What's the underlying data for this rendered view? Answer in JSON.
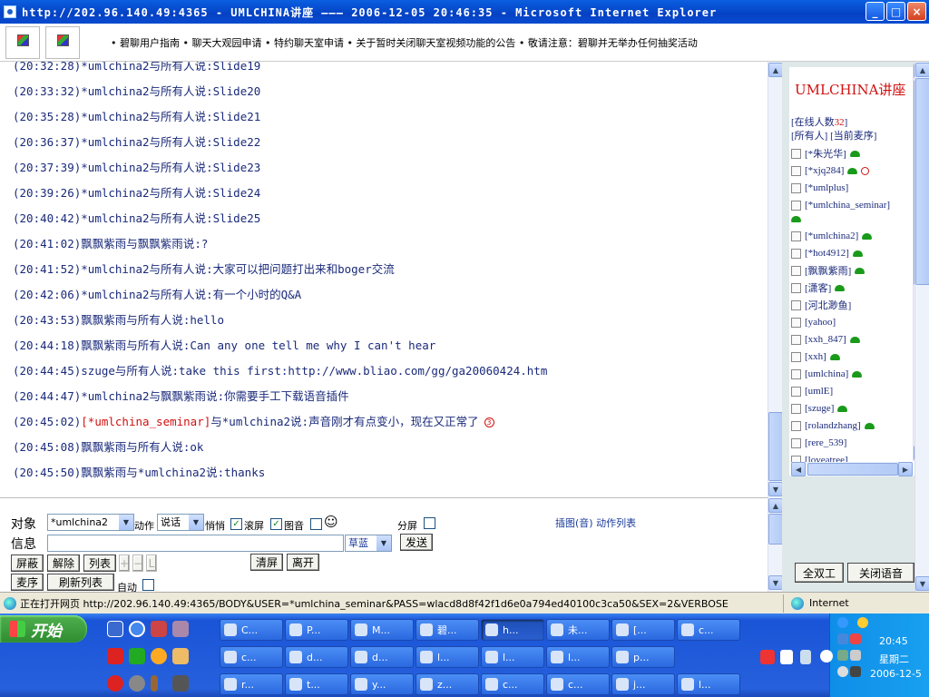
{
  "window": {
    "title": "http://202.96.140.49:4365 - UMLCHINA讲座 ——— 2006-12-05 20:46:35 - Microsoft Internet Explorer",
    "buttons": {
      "minimize": "_",
      "maximize": "□",
      "close": "×"
    }
  },
  "topbar": {
    "marquee": "• 碧聊用户指南 • 聊天大观园申请 • 特约聊天室申请 • 关于暂时关闭聊天室视频功能的公告 • 敬请注意：碧聊并无举办任何抽奖活动"
  },
  "chat": {
    "messages": [
      {
        "time": "(20:32:28)",
        "from": "*umlchina2",
        "mid": "与",
        "to": "所有人",
        "verb": "说:",
        "text": "Slide19"
      },
      {
        "time": "(20:33:32)",
        "from": "*umlchina2",
        "mid": "与",
        "to": "所有人",
        "verb": "说:",
        "text": "Slide20"
      },
      {
        "time": "(20:35:28)",
        "from": "*umlchina2",
        "mid": "与",
        "to": "所有人",
        "verb": "说:",
        "text": "Slide21"
      },
      {
        "time": "(20:36:37)",
        "from": "*umlchina2",
        "mid": "与",
        "to": "所有人",
        "verb": "说:",
        "text": "Slide22"
      },
      {
        "time": "(20:37:39)",
        "from": "*umlchina2",
        "mid": "与",
        "to": "所有人",
        "verb": "说:",
        "text": "Slide23"
      },
      {
        "time": "(20:39:26)",
        "from": "*umlchina2",
        "mid": "与",
        "to": "所有人",
        "verb": "说:",
        "text": "Slide24"
      },
      {
        "time": "(20:40:42)",
        "from": "*umlchina2",
        "mid": "与",
        "to": "所有人",
        "verb": "说:",
        "text": "Slide25"
      },
      {
        "time": "(20:41:02)",
        "from": "飘飘紫雨",
        "mid": "与",
        "to": "飘飘紫雨",
        "verb": "说:",
        "text": "?"
      },
      {
        "time": "(20:41:52)",
        "from": "*umlchina2",
        "mid": "与",
        "to": "所有人",
        "verb": "说:",
        "text": "大家可以把问题打出来和boger交流"
      },
      {
        "time": "(20:42:06)",
        "from": "*umlchina2",
        "mid": "与",
        "to": "所有人",
        "verb": "说:",
        "text": "有一个小时的Q&A"
      },
      {
        "time": "(20:43:53)",
        "from": "飘飘紫雨",
        "mid": "与",
        "to": "所有人",
        "verb": "说:",
        "text": "hello"
      },
      {
        "time": "(20:44:18)",
        "from": "飘飘紫雨",
        "mid": "与",
        "to": "所有人",
        "verb": "说:",
        "text": "Can any one tell me why I can't hear"
      },
      {
        "time": "(20:44:45)",
        "from": "szuge",
        "mid": "与",
        "to": "所有人",
        "verb": "说:",
        "text": "take this first:http://www.bliao.com/gg/ga20060424.htm"
      },
      {
        "time": "(20:44:47)",
        "from": "*umlchina2",
        "mid": "与",
        "to": "飘飘紫雨",
        "verb": "说:",
        "text": "你需要手工下载语音插件"
      },
      {
        "time": "(20:45:02)",
        "from": "[*umlchina_seminar]",
        "mid": "与",
        "to": "*umlchina2",
        "verb": "说:",
        "text": "声音刚才有点变小，现在又正常了"
      },
      {
        "time": "(20:45:08)",
        "from": "飘飘紫雨",
        "mid": "与",
        "to": "所有人",
        "verb": "说:",
        "text": "ok"
      },
      {
        "time": "(20:45:50)",
        "from": "飘飘紫雨",
        "mid": "与",
        "to": "*umlchina2",
        "verb": "说:",
        "text": "thanks"
      }
    ]
  },
  "controls": {
    "target_label": "对象",
    "target_value": "*umlchina2",
    "action_label": "动作",
    "action_value": "说话",
    "quiet_label": "悄悄",
    "scroll_label": "滚屏",
    "scroll_checked": "✓",
    "picsound_label": "图音",
    "picsound_checked": "✓",
    "smiley": "☺",
    "split_label": "分屏",
    "info_label": "信息",
    "color_value": "草蓝",
    "send": "发送",
    "block": "屏蔽",
    "unblock": "解除",
    "list": "列表",
    "plus": "+",
    "minus": "−",
    "l": "L",
    "clear": "清屏",
    "leave": "离开",
    "mic_order": "麦序",
    "refresh": "刷新列表",
    "auto_label": "自动",
    "insert_link": "插图(音) 动作列表"
  },
  "right": {
    "title": "UMLCHINA讲座",
    "online_prefix": "[在线人数",
    "online_count": "32",
    "online_suffix": "]",
    "tabs": "[所有人] [当前麦序]",
    "users": [
      {
        "name": "[*朱光华]",
        "phone": true
      },
      {
        "name": "[*xjq284]",
        "phone": true,
        "alert": true
      },
      {
        "name": "[*umlplus]"
      },
      {
        "name": "[*umlchina_seminar]",
        "phone_below": true
      },
      {
        "name": "[*umlchina2]",
        "phone": true
      },
      {
        "name": "[*hot4912]",
        "phone": true
      },
      {
        "name": "[飘飘紫雨]",
        "phone": true
      },
      {
        "name": "[潇客]",
        "phone": true
      },
      {
        "name": "[河北渺鱼]"
      },
      {
        "name": "[yahoo]"
      },
      {
        "name": "[xxh_847]",
        "phone": true
      },
      {
        "name": "[xxh]",
        "phone": true
      },
      {
        "name": "[umlchina]",
        "phone": true
      },
      {
        "name": "[umlE]"
      },
      {
        "name": "[szuge]",
        "phone": true
      },
      {
        "name": "[rolandzhang]",
        "phone": true
      },
      {
        "name": "[rere_539]"
      },
      {
        "name": "[loveatree]"
      }
    ],
    "duplex": "全双工",
    "close_voice": "关闭语音"
  },
  "status": {
    "loading": "正在打开网页 http://202.96.140.49:4365/BODY&USER=*umlchina_seminar&PASS=wlacd8d8f42f1d6e0a794ed40100c3ca50&SEX=2&VERBOSE",
    "zone": "Internet"
  },
  "taskbar": {
    "start": "开始",
    "row1": [
      "C...",
      "P...",
      "M...",
      "h...",
      "h...",
      "未...",
      "[...",
      "c..."
    ],
    "row2": [
      "c...",
      "d...",
      "d...",
      "l...",
      "l...",
      "l...",
      "p..."
    ],
    "row3": [
      "r...",
      "t...",
      "y...",
      "z...",
      "c...",
      "c...",
      "j...",
      "l..."
    ],
    "row1_labels": [
      "C...",
      "P...",
      "M...",
      "碧...",
      "h...",
      "未...",
      "[...",
      "c..."
    ],
    "time": "20:45",
    "day": "星期二",
    "date": "2006-12-5"
  }
}
